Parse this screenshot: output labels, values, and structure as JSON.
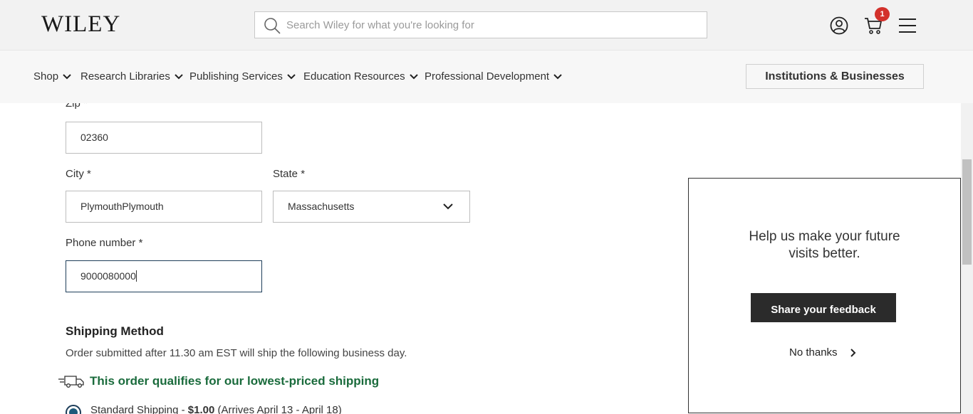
{
  "header": {
    "logo": "WILEY",
    "search_placeholder": "Search Wiley for what you're looking for",
    "cart_count": "1",
    "icons": [
      "search-icon",
      "account-icon",
      "cart-icon",
      "menu-icon"
    ]
  },
  "nav": {
    "items": [
      "Shop",
      "Research Libraries",
      "Publishing Services",
      "Education Resources",
      "Professional Development"
    ],
    "institutions_button": "Institutions & Businesses"
  },
  "form": {
    "zip_label": "Zip *",
    "zip_value": "02360",
    "city_label": "City *",
    "city_value": "PlymouthPlymouth",
    "state_label": "State *",
    "state_value": "Massachusetts",
    "phone_label": "Phone number *",
    "phone_value": "9000080000"
  },
  "shipping": {
    "heading": "Shipping Method",
    "note": "Order submitted after 11.30 am EST will ship the following business day.",
    "promo": "This order qualifies for our lowest-priced shipping",
    "option_name": "Standard Shipping - ",
    "option_price": "$1.00",
    "option_dates": " (Arrives April 13 - April 18)"
  },
  "popup": {
    "title": "Help us make your future visits better.",
    "feedback_button": "Share your feedback",
    "no_thanks": "No thanks"
  },
  "colors": {
    "header_bg": "#f2f2f2",
    "nav_bg": "#f7f7f7",
    "badge": "#d3312b",
    "promo_green": "#1a6b3c",
    "button_dark": "#2b2b2b",
    "focus_border": "#1e3e5a"
  }
}
